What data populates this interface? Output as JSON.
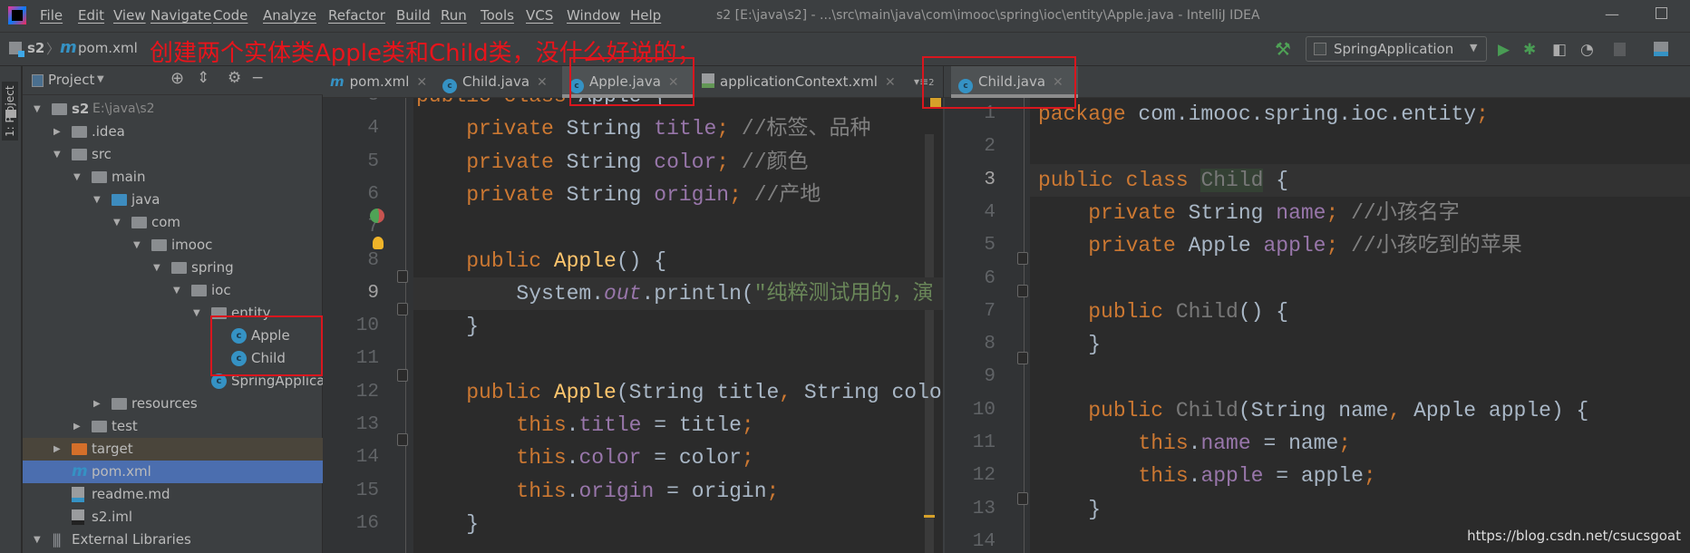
{
  "menu": {
    "items": [
      "File",
      "Edit",
      "View",
      "Navigate",
      "Code",
      "Analyze",
      "Refactor",
      "Build",
      "Run",
      "Tools",
      "VCS",
      "Window",
      "Help"
    ],
    "window_title": "s2 [E:\\java\\s2] - ...\\src\\main\\java\\com\\imooc\\spring\\ioc\\entity\\Apple.java - IntelliJ IDEA"
  },
  "toolbar": {
    "breadcrumb": [
      "s2",
      "pom.xml"
    ],
    "run_config": "SpringApplication"
  },
  "annotation": "创建两个实体类Apple类和Child类，没什么好说的；",
  "sidebar": {
    "stripe_label": "1: Project",
    "panel_title": "Project",
    "tree": [
      {
        "label": "s2",
        "extra": "E:\\java\\s2",
        "depth": 0,
        "arrow": "open",
        "icon": "module"
      },
      {
        "label": ".idea",
        "depth": 1,
        "arrow": "closed",
        "icon": "folder"
      },
      {
        "label": "src",
        "depth": 1,
        "arrow": "open",
        "icon": "folder"
      },
      {
        "label": "main",
        "depth": 2,
        "arrow": "open",
        "icon": "folder"
      },
      {
        "label": "java",
        "depth": 3,
        "arrow": "open",
        "icon": "source-folder"
      },
      {
        "label": "com",
        "depth": 4,
        "arrow": "open",
        "icon": "package"
      },
      {
        "label": "imooc",
        "depth": 5,
        "arrow": "open",
        "icon": "package"
      },
      {
        "label": "spring",
        "depth": 6,
        "arrow": "open",
        "icon": "package"
      },
      {
        "label": "ioc",
        "depth": 7,
        "arrow": "open",
        "icon": "package"
      },
      {
        "label": "entity",
        "depth": 8,
        "arrow": "open",
        "icon": "package"
      },
      {
        "label": "Apple",
        "depth": 9,
        "arrow": "none",
        "icon": "class"
      },
      {
        "label": "Child",
        "depth": 9,
        "arrow": "none",
        "icon": "class"
      },
      {
        "label": "SpringApplica",
        "depth": 8,
        "arrow": "none",
        "icon": "class"
      },
      {
        "label": "resources",
        "depth": 3,
        "arrow": "closed",
        "icon": "resources-folder"
      },
      {
        "label": "test",
        "depth": 2,
        "arrow": "closed",
        "icon": "folder"
      },
      {
        "label": "target",
        "depth": 1,
        "arrow": "closed",
        "icon": "excluded-folder"
      },
      {
        "label": "pom.xml",
        "depth": 1,
        "arrow": "none",
        "icon": "maven",
        "selected": true
      },
      {
        "label": "readme.md",
        "depth": 1,
        "arrow": "none",
        "icon": "markdown"
      },
      {
        "label": "s2.iml",
        "depth": 1,
        "arrow": "none",
        "icon": "iml"
      },
      {
        "label": "External Libraries",
        "depth": 0,
        "arrow": "open",
        "icon": "library"
      }
    ]
  },
  "left_tabs": [
    {
      "label": "pom.xml",
      "icon": "maven"
    },
    {
      "label": "Child.java",
      "icon": "class"
    },
    {
      "label": "Apple.java",
      "icon": "class",
      "active": true
    },
    {
      "label": "applicationContext.xml",
      "icon": "xml"
    }
  ],
  "tab_overflow": "2",
  "right_tabs": [
    {
      "label": "Child.java",
      "icon": "class",
      "active": true
    }
  ],
  "left_editor": {
    "first_line": 3,
    "current_line": 9,
    "lines": [
      [
        [
          "public ",
          "kw"
        ],
        [
          "class ",
          "kw"
        ],
        [
          "Apple {",
          "pl"
        ]
      ],
      [
        [
          "    private ",
          "kw"
        ],
        [
          "String ",
          "pl"
        ],
        [
          "title",
          "fd"
        ],
        [
          "; ",
          "kw"
        ],
        [
          "//标签、品种",
          "cm"
        ]
      ],
      [
        [
          "    private ",
          "kw"
        ],
        [
          "String ",
          "pl"
        ],
        [
          "color",
          "fd"
        ],
        [
          "; ",
          "kw"
        ],
        [
          "//颜色",
          "cm"
        ]
      ],
      [
        [
          "    private ",
          "kw"
        ],
        [
          "String ",
          "pl"
        ],
        [
          "origin",
          "fd"
        ],
        [
          "; ",
          "kw"
        ],
        [
          "//产地",
          "cm"
        ]
      ],
      [],
      [
        [
          "    public ",
          "kw"
        ],
        [
          "Apple",
          "fn"
        ],
        [
          "() {",
          "pl"
        ]
      ],
      [
        [
          "        System.",
          "pl"
        ],
        [
          "out",
          "it"
        ],
        [
          ".println(",
          "pl"
        ],
        [
          "\"纯粹测试用的，演",
          "st"
        ]
      ],
      [
        [
          "    }",
          "pl"
        ]
      ],
      [],
      [
        [
          "    public ",
          "kw"
        ],
        [
          "Apple",
          "fn"
        ],
        [
          "(String title",
          "pl"
        ],
        [
          ", ",
          "kw"
        ],
        [
          "String colo",
          "pl"
        ]
      ],
      [
        [
          "        this",
          "kw"
        ],
        [
          ".",
          "pl"
        ],
        [
          "title",
          "fd"
        ],
        [
          " = title",
          "pl"
        ],
        [
          ";",
          "kw"
        ]
      ],
      [
        [
          "        this",
          "kw"
        ],
        [
          ".",
          "pl"
        ],
        [
          "color",
          "fd"
        ],
        [
          " = color",
          "pl"
        ],
        [
          ";",
          "kw"
        ]
      ],
      [
        [
          "        this",
          "kw"
        ],
        [
          ".",
          "pl"
        ],
        [
          "origin",
          "fd"
        ],
        [
          " = origin",
          "pl"
        ],
        [
          ";",
          "kw"
        ]
      ],
      [
        [
          "    }",
          "pl"
        ]
      ]
    ]
  },
  "right_editor": {
    "first_line": 1,
    "current_line": 3,
    "lines": [
      [
        [
          "package ",
          "kw"
        ],
        [
          "com.imooc.spring.ioc.entity",
          "pl"
        ],
        [
          ";",
          "kw"
        ]
      ],
      [],
      [
        [
          "public ",
          "kw"
        ],
        [
          "class ",
          "kw"
        ],
        [
          "Child",
          "un cls-hl"
        ],
        [
          " {",
          "pl"
        ]
      ],
      [
        [
          "    private ",
          "kw"
        ],
        [
          "String ",
          "pl"
        ],
        [
          "name",
          "fd"
        ],
        [
          "; ",
          "kw"
        ],
        [
          "//小孩名字",
          "cm"
        ]
      ],
      [
        [
          "    private ",
          "kw"
        ],
        [
          "Apple ",
          "pl"
        ],
        [
          "apple",
          "fd"
        ],
        [
          "; ",
          "kw"
        ],
        [
          "//小孩吃到的苹果",
          "cm"
        ]
      ],
      [],
      [
        [
          "    public ",
          "kw"
        ],
        [
          "Child",
          "un"
        ],
        [
          "() {",
          "pl"
        ]
      ],
      [
        [
          "    }",
          "pl"
        ]
      ],
      [],
      [
        [
          "    public ",
          "kw"
        ],
        [
          "Child",
          "un"
        ],
        [
          "(String name",
          "pl"
        ],
        [
          ", ",
          "kw"
        ],
        [
          "Apple apple) {",
          "pl"
        ]
      ],
      [
        [
          "        this",
          "kw"
        ],
        [
          ".",
          "pl"
        ],
        [
          "name",
          "fd"
        ],
        [
          " = name",
          "pl"
        ],
        [
          ";",
          "kw"
        ]
      ],
      [
        [
          "        this",
          "kw"
        ],
        [
          ".",
          "pl"
        ],
        [
          "apple",
          "fd"
        ],
        [
          " = apple",
          "pl"
        ],
        [
          ";",
          "kw"
        ]
      ],
      [
        [
          "    }",
          "pl"
        ]
      ],
      []
    ]
  },
  "watermark": "https://blog.csdn.net/csucsgoat"
}
